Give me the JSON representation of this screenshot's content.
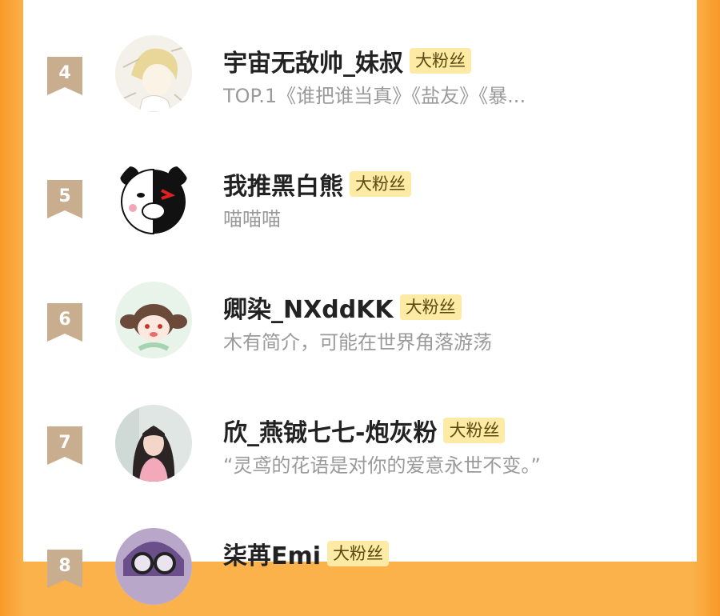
{
  "ranking": {
    "badge_label": "大粉丝",
    "colors": {
      "rank_tag": "#c8ae8e",
      "badge_bg": "#fdeaa4",
      "accent_orange": "#fbb24a"
    },
    "rows": [
      {
        "rank": "4",
        "name": "宇宙无敌帅_妹叔",
        "badge": "大粉丝",
        "bio": "TOP.1《谁把谁当真》《盐友》《暴...",
        "avatar": "anime-boy-avatar"
      },
      {
        "rank": "5",
        "name": "我推黑白熊",
        "badge": "大粉丝",
        "bio": "喵喵喵",
        "avatar": "monokuma-bear-avatar"
      },
      {
        "rank": "6",
        "name": "卿染_NXddKK",
        "badge": "大粉丝",
        "bio": "木有简介，可能在世界角落游荡",
        "avatar": "chibi-girl-avatar"
      },
      {
        "rank": "7",
        "name": "欣_燕铖七七-炮灰粉",
        "badge": "大粉丝",
        "bio": "“灵鸢的花语是对你的爱意永世不变。”",
        "avatar": "photo-girl-avatar"
      },
      {
        "rank": "8",
        "name": "柒苒Emi",
        "badge": "大粉丝",
        "bio": "",
        "avatar": "glasses-avatar"
      }
    ]
  }
}
